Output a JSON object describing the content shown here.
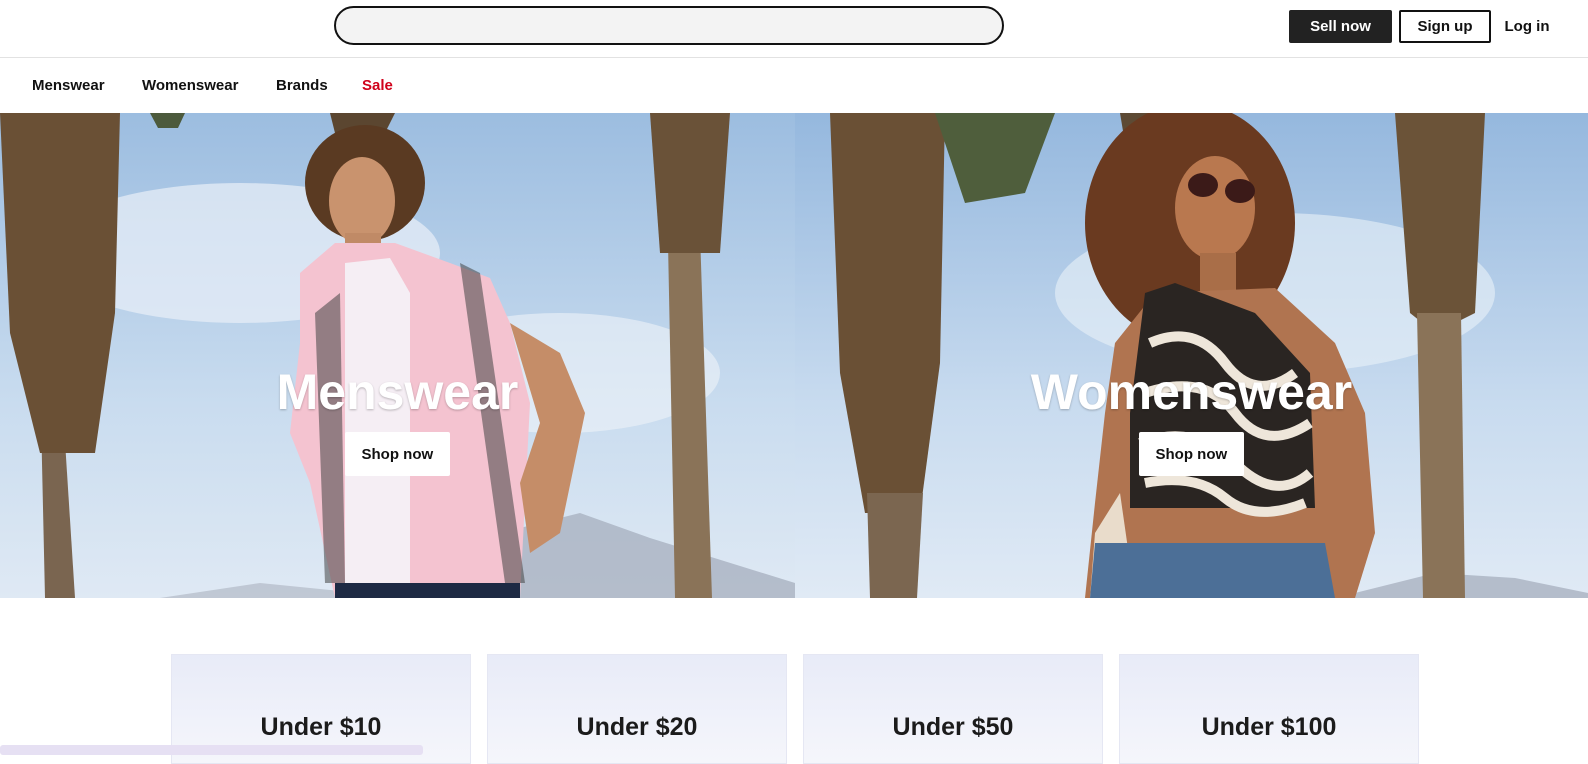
{
  "header": {
    "search_placeholder": "",
    "sell_label": "Sell now",
    "signup_label": "Sign up",
    "login_label": "Log in"
  },
  "nav": {
    "items": [
      "Menswear",
      "Womenswear",
      "Brands",
      "Sale"
    ],
    "sale_color": "#d0021b"
  },
  "hero": {
    "men": {
      "title": "Menswear",
      "cta": "Shop now"
    },
    "women": {
      "title": "Womenswear",
      "cta": "Shop now"
    }
  },
  "price_cards": [
    "Under $10",
    "Under $20",
    "Under $50",
    "Under $100"
  ],
  "colors": {
    "primary_button": "#222222",
    "card_bg": "#e8ebf8"
  }
}
